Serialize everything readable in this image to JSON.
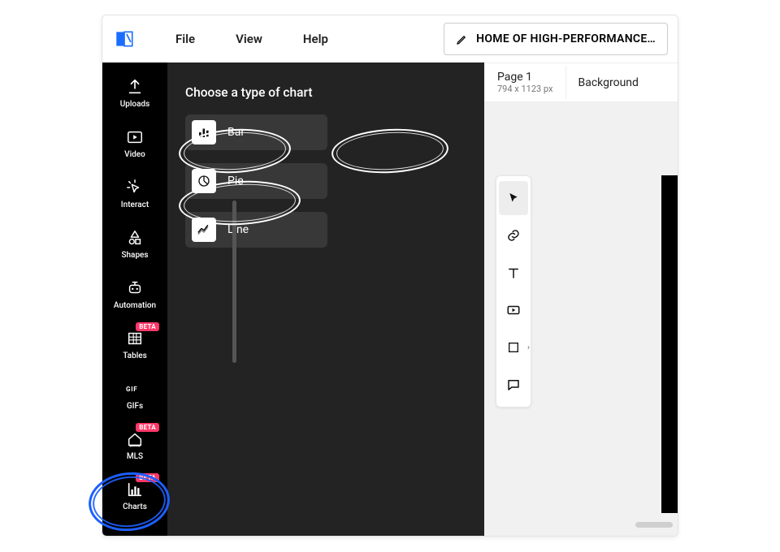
{
  "menu": {
    "file": "File",
    "view": "View",
    "help": "Help"
  },
  "doc_title": "HOME OF HIGH-PERFORMANCE…",
  "page_tab": {
    "name": "Page 1",
    "dimensions": "794 x 1123 px"
  },
  "background_tab": "Background",
  "sidebar": [
    {
      "key": "uploads",
      "label": "Uploads",
      "badge": null,
      "icon": "upload"
    },
    {
      "key": "video",
      "label": "Video",
      "badge": null,
      "icon": "play"
    },
    {
      "key": "interact",
      "label": "Interact",
      "badge": null,
      "icon": "pointer-click"
    },
    {
      "key": "shapes",
      "label": "Shapes",
      "badge": null,
      "icon": "shapes"
    },
    {
      "key": "automation",
      "label": "Automation",
      "badge": null,
      "icon": "robot"
    },
    {
      "key": "tables",
      "label": "Tables",
      "badge": "BETA",
      "icon": "table"
    },
    {
      "key": "gifs",
      "label": "GIFs",
      "badge": null,
      "icon": "gif"
    },
    {
      "key": "mls",
      "label": "MLS",
      "badge": "BETA",
      "icon": "house"
    },
    {
      "key": "charts",
      "label": "Charts",
      "badge": "BETA",
      "icon": "chart",
      "active": true
    }
  ],
  "panel": {
    "heading": "Choose a type of chart",
    "options": [
      {
        "key": "bar",
        "label": "Bar"
      },
      {
        "key": "pie",
        "label": "Pie"
      },
      {
        "key": "line",
        "label": "Line"
      }
    ]
  },
  "tools": [
    {
      "key": "select",
      "icon": "cursor",
      "active": true,
      "chevron": false
    },
    {
      "key": "link",
      "icon": "link",
      "active": false,
      "chevron": false
    },
    {
      "key": "text",
      "icon": "text",
      "active": false,
      "chevron": false
    },
    {
      "key": "media",
      "icon": "playbox",
      "active": false,
      "chevron": false
    },
    {
      "key": "shape",
      "icon": "square",
      "active": false,
      "chevron": true
    },
    {
      "key": "comment",
      "icon": "chat",
      "active": false,
      "chevron": false
    }
  ]
}
